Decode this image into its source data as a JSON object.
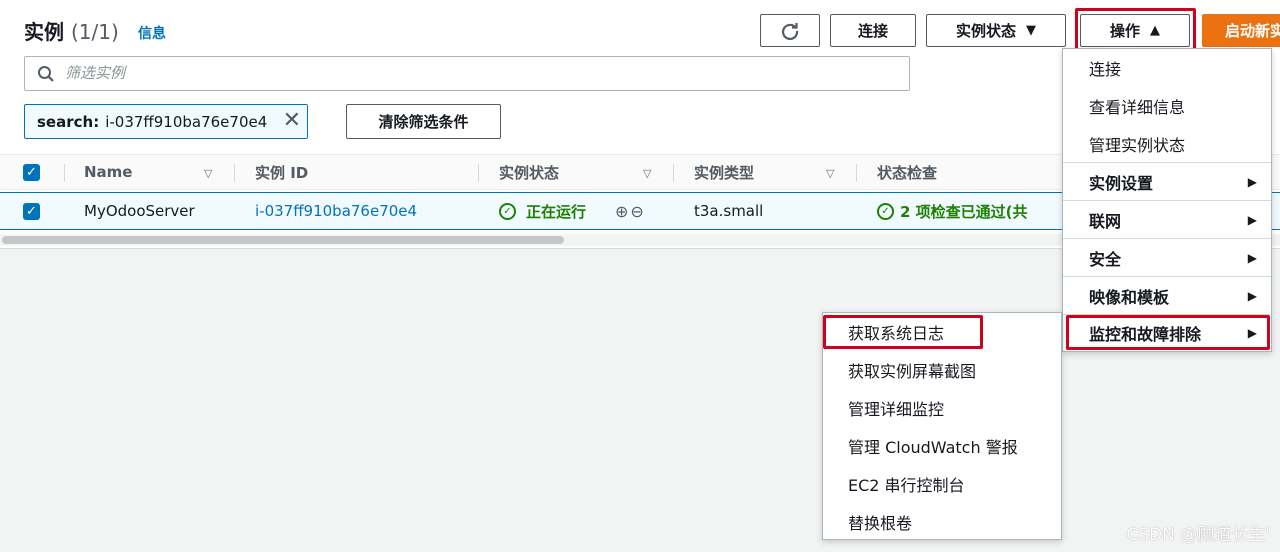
{
  "header": {
    "title": "实例",
    "count": "(1/1)",
    "info_link": "信息",
    "refresh_icon": "refresh-icon",
    "connect_label": "连接",
    "instance_state_label": "实例状态",
    "actions_label": "操作",
    "launch_label": "启动新实"
  },
  "search": {
    "placeholder": "筛选实例",
    "token_key": "search:",
    "token_value": "i-037ff910ba76e70e4",
    "clear_label": "清除筛选条件"
  },
  "table": {
    "columns": [
      "Name",
      "实例 ID",
      "实例状态",
      "实例类型",
      "状态检查"
    ],
    "rows": [
      {
        "name": "MyOdooServer",
        "instance_id": "i-037ff910ba76e70e4",
        "state": "正在运行",
        "type": "t3a.small",
        "status_check": "2 项检查已通过(共"
      }
    ]
  },
  "actions_menu": {
    "items": [
      {
        "label": "连接",
        "bold": false,
        "submenu": false
      },
      {
        "label": "查看详细信息",
        "bold": false,
        "submenu": false
      },
      {
        "label": "管理实例状态",
        "bold": false,
        "submenu": false
      },
      {
        "label": "实例设置",
        "bold": true,
        "submenu": true
      },
      {
        "label": "联网",
        "bold": true,
        "submenu": true
      },
      {
        "label": "安全",
        "bold": true,
        "submenu": true
      },
      {
        "label": "映像和模板",
        "bold": true,
        "submenu": true
      },
      {
        "label": "监控和故障排除",
        "bold": true,
        "submenu": true
      }
    ]
  },
  "monitor_submenu": {
    "items": [
      "获取系统日志",
      "获取实例屏幕截图",
      "管理详细监控",
      "管理 CloudWatch 警报",
      "EC2 串行控制台",
      "替换根卷"
    ]
  },
  "watermark": "CSDN @顾道长生'",
  "colors": {
    "link": "#0073bb",
    "success": "#1d8102",
    "launch": "#ec7211",
    "highlight": "#d0021b"
  }
}
